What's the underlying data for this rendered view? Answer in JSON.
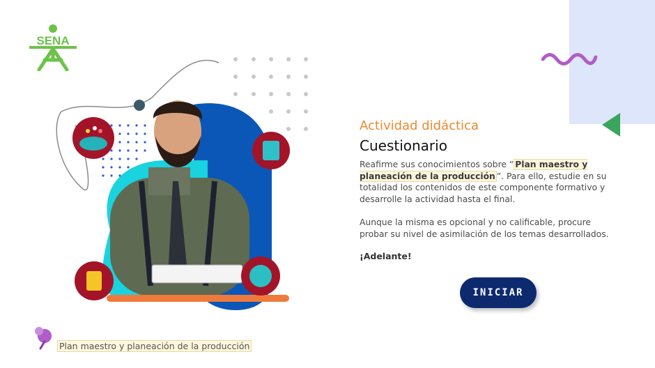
{
  "logo": {
    "text": "SENA"
  },
  "activity": {
    "subtitle": "Actividad didáctica",
    "title": "Cuestionario"
  },
  "paragraph1": {
    "before": "Reafirme sus conocimientos sobre “",
    "highlight": "Plan maestro y planeación de la producción",
    "after": "”.  Para ello, estudie en su totalidad los contenidos de este componente formativo y desarrolle la actividad hasta el final."
  },
  "paragraph2": "Aunque la misma es opcional y no calificable, procure probar su nivel de asimilación de los temas desarrollados.",
  "adelante": "¡Adelante!",
  "start_button": "INICIAR",
  "footer": {
    "label": "Plan maestro y planeación de la producción"
  },
  "colors": {
    "accent_orange": "#e88a2f",
    "button_navy": "#0d2a6e",
    "sena_green": "#6cc24a",
    "deco_blue": "#dde6fb",
    "deco_purple": "#b05cc9"
  }
}
